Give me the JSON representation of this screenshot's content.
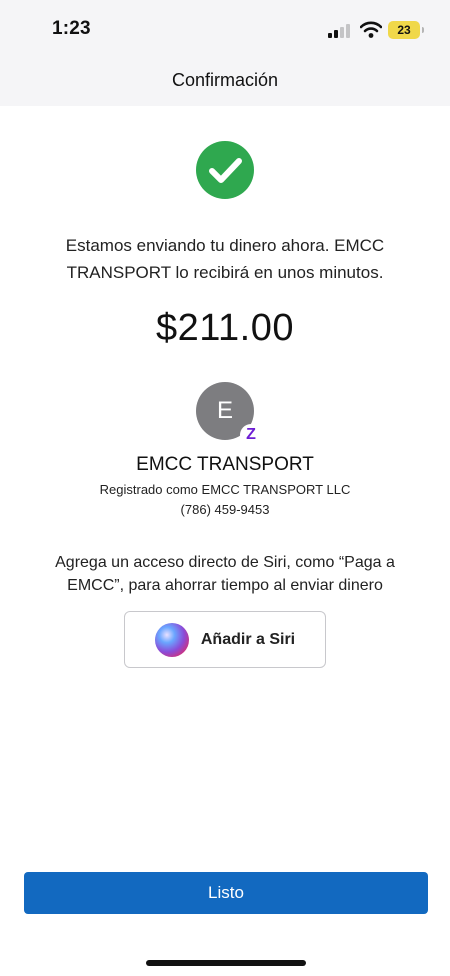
{
  "status_bar": {
    "time": "1:23",
    "battery_level": "23",
    "battery_color": "#f0d84a",
    "icons": [
      "signal-icon",
      "wifi-icon",
      "battery-icon"
    ]
  },
  "header": {
    "title": "Confirmación"
  },
  "confirmation": {
    "icon": "checkmark-icon",
    "icon_color": "#2fa84f",
    "message": "Estamos enviando tu dinero ahora. EMCC TRANSPORT lo recibirá en unos minutos.",
    "amount": "$211.00"
  },
  "recipient": {
    "initial": "E",
    "badge_icon": "zelle-icon",
    "badge_glyph": "Z",
    "name": "EMCC TRANSPORT",
    "registered_as": "Registrado como EMCC TRANSPORT LLC",
    "phone": "(786) 459-9453"
  },
  "siri": {
    "prompt": "Agrega un acceso directo de Siri, como “Paga a EMCC”, para ahorrar tiempo al enviar dinero",
    "button_label": "Añadir a Siri",
    "icon": "siri-icon"
  },
  "footer": {
    "done_label": "Listo",
    "button_color": "#1269c0"
  }
}
